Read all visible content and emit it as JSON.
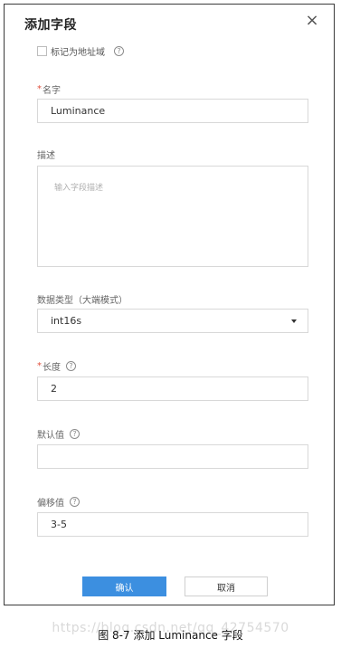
{
  "dialog": {
    "title": "添加字段",
    "close_symbol": "×",
    "address_checkbox": {
      "label": "标记为地址域",
      "checked": false
    },
    "help_symbol": "?",
    "name": {
      "required_mark": "*",
      "label": "名字",
      "value": "Luminance"
    },
    "description": {
      "label": "描述",
      "placeholder": "输入字段描述"
    },
    "data_type": {
      "label": "数据类型（大端模式）",
      "value": "int16s"
    },
    "length": {
      "required_mark": "*",
      "label": "长度",
      "value": "2"
    },
    "default_value": {
      "label": "默认值",
      "value": ""
    },
    "offset": {
      "label": "偏移值",
      "value": "3-5"
    },
    "buttons": {
      "confirm": "确认",
      "cancel": "取消"
    }
  },
  "caption": "图 8-7 添加 Luminance 字段",
  "watermark": "https://blog.csdn.net/qq_42754570",
  "colors": {
    "primary": "#3c8fe0",
    "required": "#e0503d",
    "border": "#d8d8d8"
  },
  "icons": {
    "close": "close-icon",
    "help": "help-circle-icon",
    "caret": "caret-down-icon"
  }
}
